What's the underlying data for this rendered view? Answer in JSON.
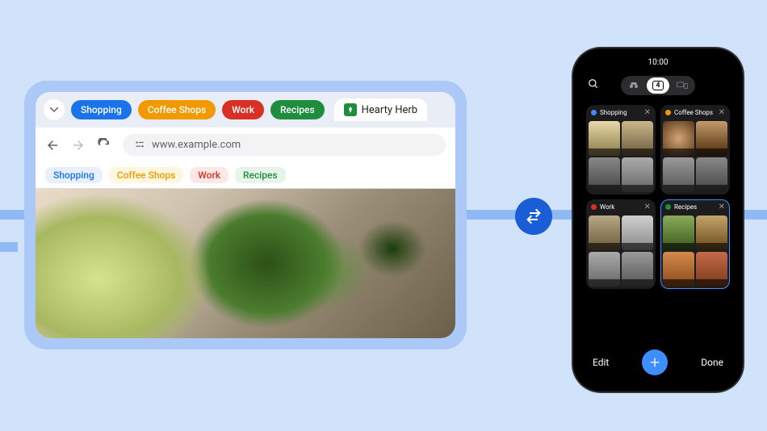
{
  "desktop": {
    "groups": [
      {
        "label": "Shopping",
        "color": "blue"
      },
      {
        "label": "Coffee Shops",
        "color": "orange"
      },
      {
        "label": "Work",
        "color": "red"
      },
      {
        "label": "Recipes",
        "color": "green"
      }
    ],
    "active_tab": {
      "label": "Hearty Herb"
    },
    "url": "www.example.com",
    "bookmarks": [
      {
        "label": "Shopping",
        "color": "blue"
      },
      {
        "label": "Coffee Shops",
        "color": "orange"
      },
      {
        "label": "Work",
        "color": "red"
      },
      {
        "label": "Recipes",
        "color": "green"
      }
    ]
  },
  "phone": {
    "time": "10:00",
    "tab_count": "4",
    "groups": [
      {
        "label": "Shopping",
        "color": "blue"
      },
      {
        "label": "Coffee Shops",
        "color": "orange"
      },
      {
        "label": "Work",
        "color": "red"
      },
      {
        "label": "Recipes",
        "color": "green"
      }
    ],
    "edit": "Edit",
    "done": "Done"
  }
}
